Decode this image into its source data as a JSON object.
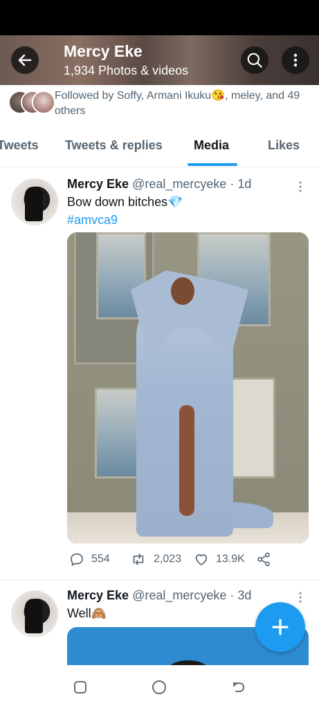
{
  "header": {
    "title": "Mercy Eke",
    "subtitle": "1,934 Photos & videos"
  },
  "followed_by": {
    "text": "Followed by Soffy, Armani Ikuku😘, meley, and 49 others"
  },
  "tabs": [
    {
      "label": "Tweets"
    },
    {
      "label": "Tweets & replies"
    },
    {
      "label": "Media"
    },
    {
      "label": "Likes"
    }
  ],
  "tweets": [
    {
      "name": "Mercy Eke",
      "handle": "@real_mercyeke",
      "time": "· 1d",
      "text": "Bow down bitches💎",
      "hashtag": "#amvca9",
      "replies": "554",
      "retweets": "2,023",
      "likes": "13.9K"
    },
    {
      "name": "Mercy Eke",
      "handle": "@real_mercyeke",
      "time": "· 3d",
      "text": "Well🙈"
    }
  ],
  "colors": {
    "accent": "#1d9bf0",
    "text_primary": "#0f1419",
    "text_secondary": "#536471"
  },
  "icons": {
    "back": "arrow-left-icon",
    "search": "search-icon",
    "more": "more-vertical-icon",
    "reply": "reply-icon",
    "retweet": "retweet-icon",
    "like": "heart-icon",
    "share": "share-icon",
    "compose": "plus-icon"
  }
}
